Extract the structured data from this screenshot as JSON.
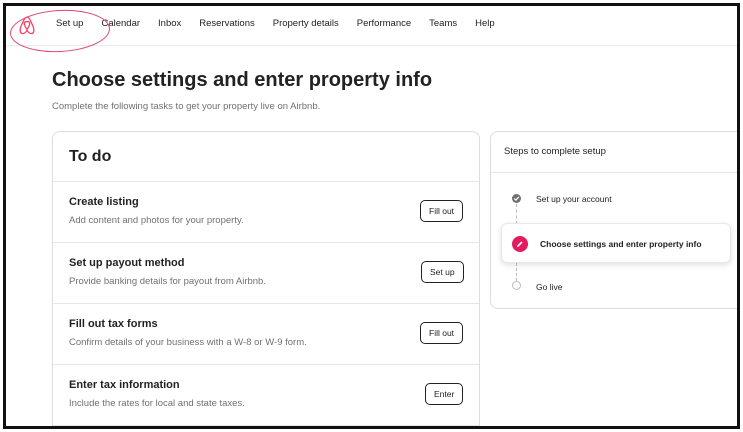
{
  "nav": {
    "logo_icon": "airbnb-logo-icon",
    "items": [
      "Set up",
      "Calendar",
      "Inbox",
      "Reservations",
      "Property details",
      "Performance",
      "Teams",
      "Help"
    ],
    "highlight_color": "#e0457b"
  },
  "header": {
    "title": "Choose settings and enter property info",
    "subtitle": "Complete the following tasks to get your property live on Airbnb."
  },
  "todo": {
    "heading": "To do",
    "tasks": [
      {
        "title": "Create listing",
        "description": "Add content and photos for your property.",
        "button": "Fill out"
      },
      {
        "title": "Set up payout method",
        "description": "Provide banking details for payout from Airbnb.",
        "button": "Set up"
      },
      {
        "title": "Fill out tax forms",
        "description": "Confirm details of your business with a W-8 or W-9 form.",
        "button": "Fill out"
      },
      {
        "title": "Enter tax information",
        "description": "Include the rates for local and state taxes.",
        "button": "Enter"
      }
    ]
  },
  "steps": {
    "heading": "Steps to complete setup",
    "items": [
      {
        "label": "Set up your account",
        "status": "complete",
        "icon": "check-icon"
      },
      {
        "label": "Choose settings and enter property info",
        "status": "current",
        "icon": "pencil-icon"
      },
      {
        "label": "Go live",
        "status": "pending",
        "icon": "empty-circle-icon"
      }
    ],
    "accent_color": "#e31c5f"
  }
}
